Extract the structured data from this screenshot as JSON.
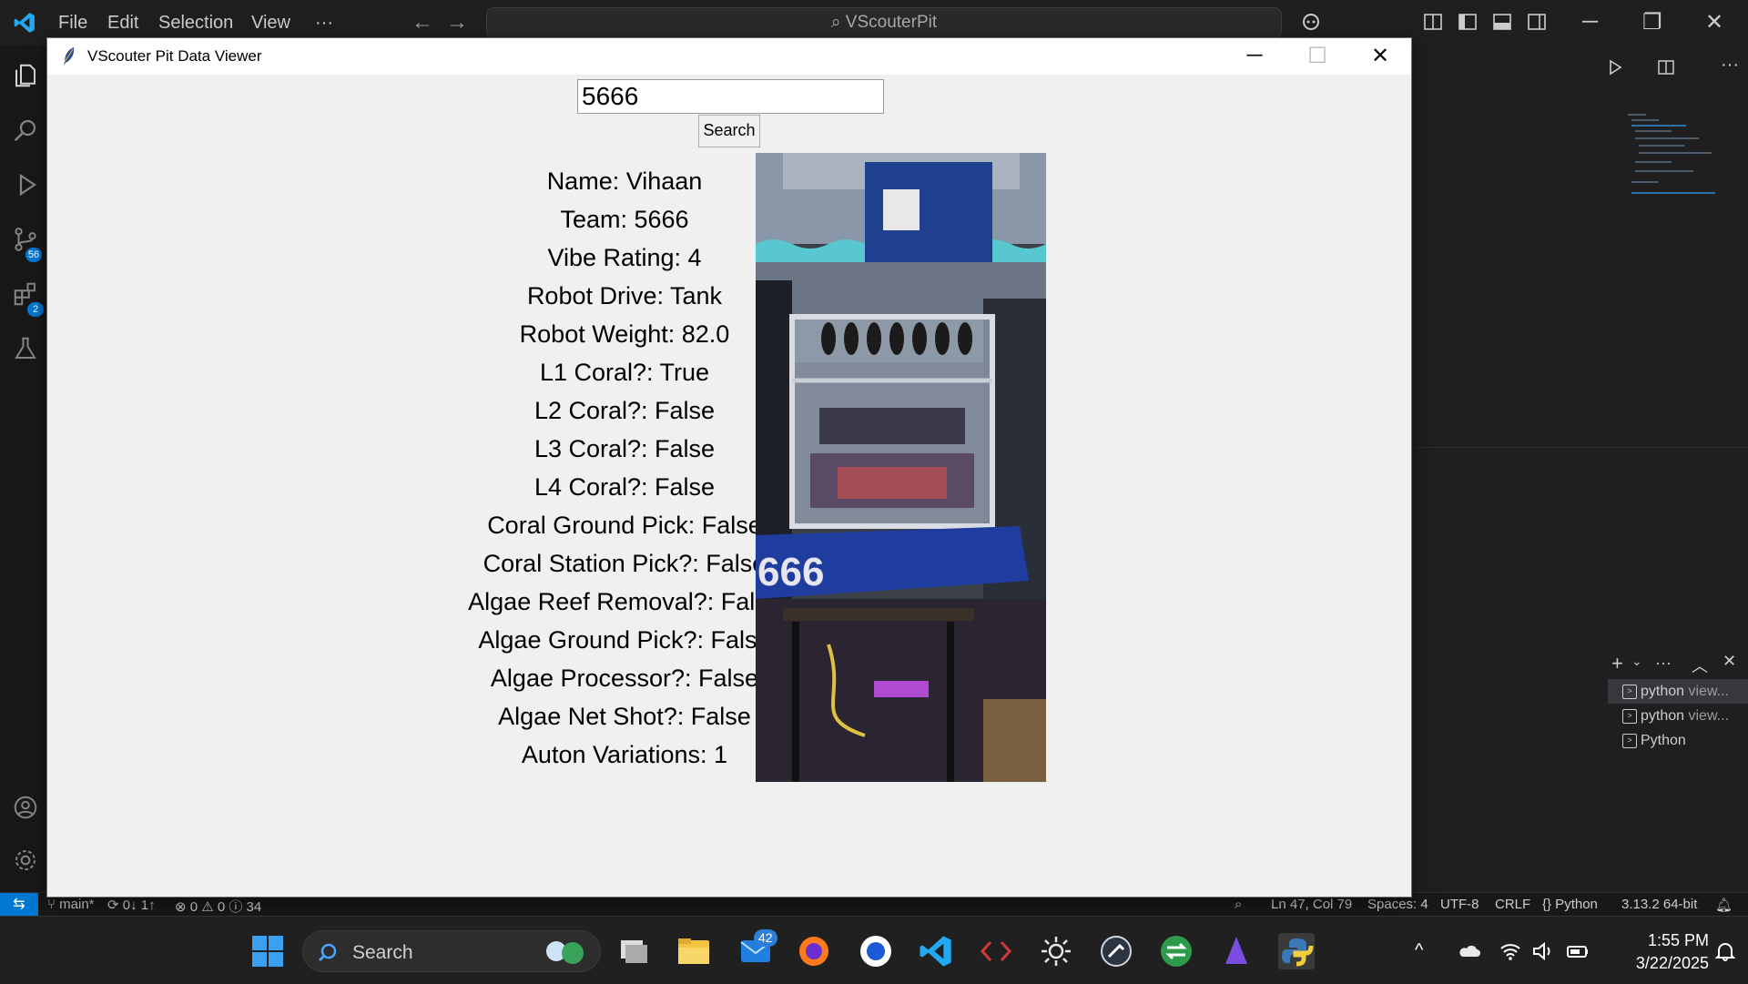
{
  "vscode": {
    "menu": [
      "File",
      "Edit",
      "Selection",
      "View",
      "···"
    ],
    "command_center": "VScouterPit",
    "badges": {
      "source_control": "56",
      "extensions": "2"
    },
    "status_bar": {
      "branch": "main*",
      "sync": "0↓ 1↑",
      "problems": "⊗ 0 ⚠ 0 ⓘ 34",
      "position": "Ln 47, Col 79",
      "spaces": "Spaces: 4",
      "encoding": "UTF-8",
      "eol": "CRLF",
      "language": "{} Python",
      "interpreter": "3.13.2 64-bit"
    },
    "terminals": [
      {
        "name": "python",
        "sub": "view..."
      },
      {
        "name": "python",
        "sub": "view..."
      },
      {
        "name": "Python",
        "sub": ""
      }
    ]
  },
  "app": {
    "window_title": "VScouter Pit Data Viewer",
    "search_value": "5666",
    "search_button": "Search",
    "fields": [
      "Name: Vihaan",
      "Team: 5666",
      "Vibe Rating: 4",
      "Robot Drive: Tank",
      "Robot Weight: 82.0",
      "L1 Coral?: True",
      "L2 Coral?: False",
      "L3 Coral?: False",
      "L4 Coral?: False",
      "Coral Ground Pick: False",
      "Coral Station Pick?: False",
      "Algae Reef Removal?: False",
      "Algae Ground Pick?: False",
      "Algae Processor?: False",
      "Algae Net Shot?: False",
      "Auton Variations: 1"
    ],
    "photo_text": "666"
  },
  "taskbar": {
    "search_label": "Search",
    "mail_badge": "42",
    "time": "1:55 PM",
    "date": "3/22/2025"
  }
}
